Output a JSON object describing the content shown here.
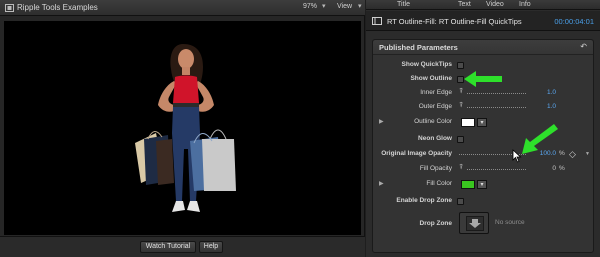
{
  "viewer": {
    "title": "Ripple Tools Examples",
    "zoom": "97%",
    "view_label": "View",
    "footer": {
      "watch_tutorial": "Watch Tutorial",
      "help": "Help"
    }
  },
  "inspector": {
    "tabs": [
      {
        "label": "Title"
      },
      {
        "label": "Text"
      },
      {
        "label": "Video"
      },
      {
        "label": "Info"
      }
    ],
    "clip_name": "RT Outline-Fill: RT Outline-Fill QuickTips",
    "timecode": "00:00:04:01",
    "panel_title": "Published Parameters",
    "params": {
      "show_quicktips": {
        "label": "Show QuickTips",
        "checked": false
      },
      "show_outline": {
        "label": "Show Outline",
        "checked": false
      },
      "inner_edge": {
        "label": "Inner Edge",
        "value": "1.0"
      },
      "outer_edge": {
        "label": "Outer Edge",
        "value": "1.0"
      },
      "outline_color": {
        "label": "Outline Color",
        "color": "#ffffff"
      },
      "neon_glow": {
        "label": "Neon Glow",
        "checked": false
      },
      "original_image_opacity": {
        "label": "Original Image Opacity",
        "value": "100.0",
        "unit": "%"
      },
      "fill_opacity": {
        "label": "Fill Opacity",
        "value": "0",
        "unit": "%"
      },
      "fill_color": {
        "label": "Fill Color",
        "color": "#39c51f"
      },
      "enable_drop_zone": {
        "label": "Enable Drop Zone",
        "checked": false
      },
      "drop_zone": {
        "label": "Drop Zone",
        "placeholder": "No source"
      }
    }
  },
  "colors": {
    "accent_blue": "#4a9fe8",
    "annotation_arrow": "#2ee02b",
    "fill_green": "#39c51f"
  },
  "icons": [
    "film-icon",
    "chevron-down-icon",
    "reset-icon",
    "slider-icon",
    "keyframe-diamond-icon",
    "drop-zone-arrow-icon",
    "disclosure-triangle-icon",
    "mouse-cursor-icon"
  ]
}
